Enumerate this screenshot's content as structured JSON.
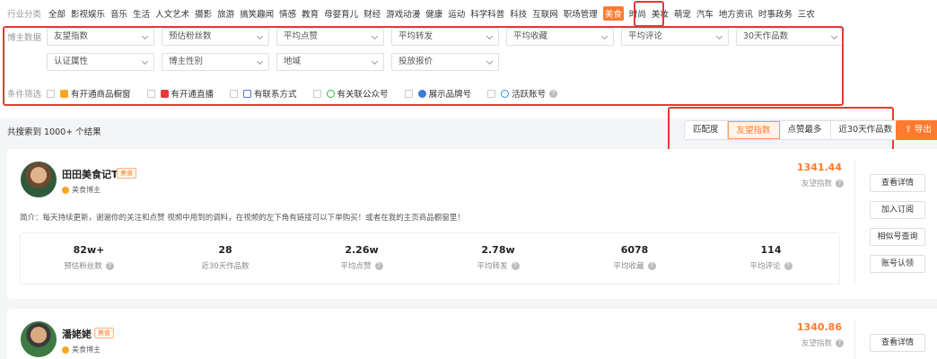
{
  "categories": {
    "label": "行业分类",
    "items": [
      "全部",
      "影视娱乐",
      "音乐",
      "生活",
      "人文艺术",
      "摄影",
      "旅游",
      "搞笑趣闻",
      "情感",
      "教育",
      "母婴育儿",
      "财经",
      "游戏动漫",
      "健康",
      "运动",
      "科学科普",
      "科技",
      "互联网",
      "职场管理",
      "美食",
      "时尚",
      "美妆",
      "萌宠",
      "汽车",
      "地方资讯",
      "时事政务",
      "三农"
    ],
    "active": "美食"
  },
  "blogger_data": {
    "label": "博主数据",
    "row1": [
      "友望指数",
      "预估粉丝数",
      "平均点赞",
      "平均转发",
      "平均收藏",
      "平均评论",
      "30天作品数"
    ],
    "row2": [
      "认证属性",
      "博主性别",
      "地域",
      "投放报价"
    ]
  },
  "conditions": {
    "label": "条件筛选",
    "items": [
      "有开通商品橱窗",
      "有开通直播",
      "有联系方式",
      "有关联公众号",
      "展示品牌号",
      "活跃账号"
    ]
  },
  "results": {
    "text": "共搜索到 1000+ 个结果",
    "sort": [
      "匹配度",
      "友望指数",
      "点赞最多",
      "近30天作品数"
    ],
    "active_sort": "友望指数",
    "export": "导出"
  },
  "cards": [
    {
      "name": "田田美食记T",
      "tag": "美食",
      "verified": "美食博主",
      "score": "1341.44",
      "score_label": "友望指数",
      "intro": "简介：每天持续更新，谢谢你的关注和点赞 视频中用到的调料，在视频的左下角有链接可以下单购买！或者在我的主页商品橱窗里！",
      "stats": [
        {
          "value": "82w+",
          "label": "预估粉丝数"
        },
        {
          "value": "28",
          "label": "近30天作品数"
        },
        {
          "value": "2.26w",
          "label": "平均点赞"
        },
        {
          "value": "2.78w",
          "label": "平均转发"
        },
        {
          "value": "6078",
          "label": "平均收藏"
        },
        {
          "value": "114",
          "label": "平均评论"
        }
      ],
      "actions": [
        "查看详情",
        "加入订阅",
        "相似号查询",
        "账号认领"
      ]
    },
    {
      "name": "潘姥姥",
      "tag": "美食",
      "verified": "美食博主",
      "score": "1340.86",
      "score_label": "友望指数",
      "actions": [
        "查看详情"
      ]
    }
  ],
  "colors": {
    "accent": "#ff7a2e",
    "highlight_box": "#e53935"
  }
}
